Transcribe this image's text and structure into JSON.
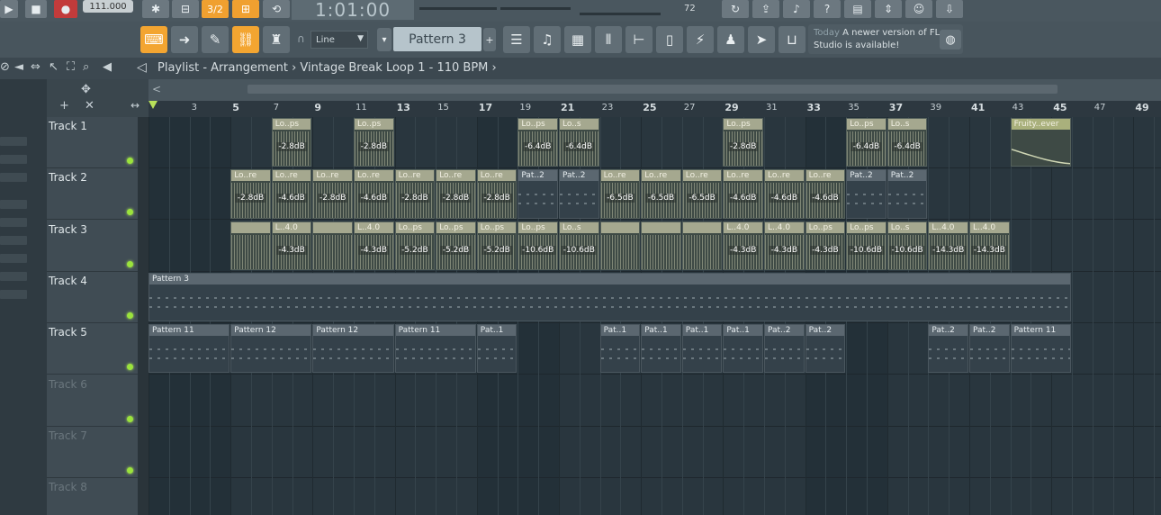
{
  "toolbar": {
    "tempo": "111.000",
    "time": "1:01:00",
    "volume_value": "72",
    "pattern_mode": "3/2",
    "snap": "Line",
    "pattern": "Pattern 3",
    "news_today": "Today",
    "news_text": "A newer version of FL Studio is available!"
  },
  "playlist": {
    "title": "Playlist - Arrangement › Vintage Break Loop 1 - 110 BPM ›"
  },
  "ruler": [
    {
      "bar": 1,
      "label": ""
    },
    {
      "bar": 3,
      "label": "3"
    },
    {
      "bar": 5,
      "label": "5"
    },
    {
      "bar": 7,
      "label": "7"
    },
    {
      "bar": 9,
      "label": "9"
    },
    {
      "bar": 11,
      "label": "11"
    },
    {
      "bar": 13,
      "label": "13"
    },
    {
      "bar": 15,
      "label": "15"
    },
    {
      "bar": 17,
      "label": "17"
    },
    {
      "bar": 19,
      "label": "19"
    },
    {
      "bar": 21,
      "label": "21"
    },
    {
      "bar": 23,
      "label": "23"
    },
    {
      "bar": 25,
      "label": "25"
    },
    {
      "bar": 27,
      "label": "27"
    },
    {
      "bar": 29,
      "label": "29"
    },
    {
      "bar": 31,
      "label": "31"
    },
    {
      "bar": 33,
      "label": "33"
    },
    {
      "bar": 35,
      "label": "35"
    },
    {
      "bar": 37,
      "label": "37"
    },
    {
      "bar": 39,
      "label": "39"
    },
    {
      "bar": 41,
      "label": "41"
    },
    {
      "bar": 43,
      "label": "43"
    },
    {
      "bar": 45,
      "label": "45"
    },
    {
      "bar": 47,
      "label": "47"
    },
    {
      "bar": 49,
      "label": "49"
    }
  ],
  "tracks": [
    {
      "name": "Track 1",
      "dim": false
    },
    {
      "name": "Track 2",
      "dim": false
    },
    {
      "name": "Track 3",
      "dim": false
    },
    {
      "name": "Track 4",
      "dim": false
    },
    {
      "name": "Track 5",
      "dim": false
    },
    {
      "name": "Track 6",
      "dim": true
    },
    {
      "name": "Track 7",
      "dim": true
    },
    {
      "name": "Track 8",
      "dim": true
    }
  ],
  "clips": [
    {
      "track": 0,
      "start": 7,
      "len": 2,
      "kind": "audio",
      "label": "Lo..ps",
      "db": "-2.8dB"
    },
    {
      "track": 0,
      "start": 11,
      "len": 2,
      "kind": "audio",
      "label": "Lo..ps",
      "db": "-2.8dB"
    },
    {
      "track": 0,
      "start": 19,
      "len": 2,
      "kind": "audio",
      "label": "Lo..ps",
      "db": "-6.4dB"
    },
    {
      "track": 0,
      "start": 21,
      "len": 2,
      "kind": "audio",
      "label": "Lo..s",
      "db": "-6.4dB"
    },
    {
      "track": 0,
      "start": 29,
      "len": 2,
      "kind": "audio",
      "label": "Lo..ps",
      "db": "-2.8dB"
    },
    {
      "track": 0,
      "start": 35,
      "len": 2,
      "kind": "audio",
      "label": "Lo..ps",
      "db": "-6.4dB"
    },
    {
      "track": 0,
      "start": 37,
      "len": 2,
      "kind": "audio",
      "label": "Lo..s",
      "db": "-6.4dB"
    },
    {
      "track": 0,
      "start": 43,
      "len": 3,
      "kind": "auto",
      "label": "Fruity..ever",
      "db": ""
    },
    {
      "track": 1,
      "start": 5,
      "len": 2,
      "kind": "audio",
      "label": "Lo..re",
      "db": "-2.8dB"
    },
    {
      "track": 1,
      "start": 7,
      "len": 2,
      "kind": "audio",
      "label": "Lo..re",
      "db": "-4.6dB"
    },
    {
      "track": 1,
      "start": 9,
      "len": 2,
      "kind": "audio",
      "label": "Lo..re",
      "db": "-2.8dB"
    },
    {
      "track": 1,
      "start": 11,
      "len": 2,
      "kind": "audio",
      "label": "Lo..re",
      "db": "-4.6dB"
    },
    {
      "track": 1,
      "start": 13,
      "len": 2,
      "kind": "audio",
      "label": "Lo..re",
      "db": "-2.8dB"
    },
    {
      "track": 1,
      "start": 15,
      "len": 2,
      "kind": "audio",
      "label": "Lo..re",
      "db": "-2.8dB"
    },
    {
      "track": 1,
      "start": 17,
      "len": 2,
      "kind": "audio",
      "label": "Lo..re",
      "db": "-2.8dB"
    },
    {
      "track": 1,
      "start": 19,
      "len": 2,
      "kind": "pattern",
      "label": "Pat..2",
      "db": ""
    },
    {
      "track": 1,
      "start": 21,
      "len": 2,
      "kind": "pattern",
      "label": "Pat..2",
      "db": ""
    },
    {
      "track": 1,
      "start": 23,
      "len": 2,
      "kind": "audio",
      "label": "Lo..re",
      "db": "-6.5dB"
    },
    {
      "track": 1,
      "start": 25,
      "len": 2,
      "kind": "audio",
      "label": "Lo..re",
      "db": "-6.5dB"
    },
    {
      "track": 1,
      "start": 27,
      "len": 2,
      "kind": "audio",
      "label": "Lo..re",
      "db": "-6.5dB"
    },
    {
      "track": 1,
      "start": 29,
      "len": 2,
      "kind": "audio",
      "label": "Lo..re",
      "db": "-4.6dB"
    },
    {
      "track": 1,
      "start": 31,
      "len": 2,
      "kind": "audio",
      "label": "Lo..re",
      "db": "-4.6dB"
    },
    {
      "track": 1,
      "start": 33,
      "len": 2,
      "kind": "audio",
      "label": "Lo..re",
      "db": "-4.6dB"
    },
    {
      "track": 1,
      "start": 35,
      "len": 2,
      "kind": "pattern",
      "label": "Pat..2",
      "db": ""
    },
    {
      "track": 1,
      "start": 37,
      "len": 2,
      "kind": "pattern",
      "label": "Pat..2",
      "db": ""
    },
    {
      "track": 2,
      "start": 5,
      "len": 2,
      "kind": "audio",
      "label": "",
      "db": ""
    },
    {
      "track": 2,
      "start": 7,
      "len": 2,
      "kind": "audio",
      "label": "L..4.0",
      "db": "-4.3dB"
    },
    {
      "track": 2,
      "start": 9,
      "len": 2,
      "kind": "audio",
      "label": "",
      "db": ""
    },
    {
      "track": 2,
      "start": 11,
      "len": 2,
      "kind": "audio",
      "label": "L..4.0",
      "db": "-4.3dB"
    },
    {
      "track": 2,
      "start": 13,
      "len": 2,
      "kind": "audio",
      "label": "Lo..ps",
      "db": "-5.2dB"
    },
    {
      "track": 2,
      "start": 15,
      "len": 2,
      "kind": "audio",
      "label": "Lo..ps",
      "db": "-5.2dB"
    },
    {
      "track": 2,
      "start": 17,
      "len": 2,
      "kind": "audio",
      "label": "Lo..ps",
      "db": "-5.2dB"
    },
    {
      "track": 2,
      "start": 19,
      "len": 2,
      "kind": "audio",
      "label": "Lo..ps",
      "db": "-10.6dB"
    },
    {
      "track": 2,
      "start": 21,
      "len": 2,
      "kind": "audio",
      "label": "Lo..s",
      "db": "-10.6dB"
    },
    {
      "track": 2,
      "start": 23,
      "len": 2,
      "kind": "audio",
      "label": "",
      "db": ""
    },
    {
      "track": 2,
      "start": 25,
      "len": 2,
      "kind": "audio",
      "label": "",
      "db": ""
    },
    {
      "track": 2,
      "start": 27,
      "len": 2,
      "kind": "audio",
      "label": "",
      "db": ""
    },
    {
      "track": 2,
      "start": 29,
      "len": 2,
      "kind": "audio",
      "label": "L..4.0",
      "db": "-4.3dB"
    },
    {
      "track": 2,
      "start": 31,
      "len": 2,
      "kind": "audio",
      "label": "L..4.0",
      "db": "-4.3dB"
    },
    {
      "track": 2,
      "start": 33,
      "len": 2,
      "kind": "audio",
      "label": "Lo..ps",
      "db": "-4.3dB"
    },
    {
      "track": 2,
      "start": 35,
      "len": 2,
      "kind": "audio",
      "label": "Lo..ps",
      "db": "-10.6dB"
    },
    {
      "track": 2,
      "start": 37,
      "len": 2,
      "kind": "audio",
      "label": "Lo..s",
      "db": "-10.6dB"
    },
    {
      "track": 2,
      "start": 39,
      "len": 2,
      "kind": "audio",
      "label": "L..4.0",
      "db": "-14.3dB"
    },
    {
      "track": 2,
      "start": 41,
      "len": 2,
      "kind": "audio",
      "label": "L..4.0",
      "db": "-14.3dB"
    },
    {
      "track": 3,
      "start": 1,
      "len": 45,
      "kind": "pattern",
      "label": "Pattern 3",
      "db": ""
    },
    {
      "track": 4,
      "start": 1,
      "len": 4,
      "kind": "pattern",
      "label": "Pattern 11",
      "db": ""
    },
    {
      "track": 4,
      "start": 5,
      "len": 4,
      "kind": "pattern",
      "label": "Pattern 12",
      "db": ""
    },
    {
      "track": 4,
      "start": 9,
      "len": 4,
      "kind": "pattern",
      "label": "Pattern 12",
      "db": ""
    },
    {
      "track": 4,
      "start": 13,
      "len": 4,
      "kind": "pattern",
      "label": "Pattern 11",
      "db": ""
    },
    {
      "track": 4,
      "start": 17,
      "len": 2,
      "kind": "pattern",
      "label": "Pat..1",
      "db": ""
    },
    {
      "track": 4,
      "start": 23,
      "len": 2,
      "kind": "pattern",
      "label": "Pat..1",
      "db": ""
    },
    {
      "track": 4,
      "start": 25,
      "len": 2,
      "kind": "pattern",
      "label": "Pat..1",
      "db": ""
    },
    {
      "track": 4,
      "start": 27,
      "len": 2,
      "kind": "pattern",
      "label": "Pat..1",
      "db": ""
    },
    {
      "track": 4,
      "start": 29,
      "len": 2,
      "kind": "pattern",
      "label": "Pat..1",
      "db": ""
    },
    {
      "track": 4,
      "start": 31,
      "len": 2,
      "kind": "pattern",
      "label": "Pat..2",
      "db": ""
    },
    {
      "track": 4,
      "start": 33,
      "len": 2,
      "kind": "pattern",
      "label": "Pat..2",
      "db": ""
    },
    {
      "track": 4,
      "start": 39,
      "len": 2,
      "kind": "pattern",
      "label": "Pat..2",
      "db": ""
    },
    {
      "track": 4,
      "start": 41,
      "len": 2,
      "kind": "pattern",
      "label": "Pat..2",
      "db": ""
    },
    {
      "track": 4,
      "start": 43,
      "len": 3,
      "kind": "pattern",
      "label": "Pattern 11",
      "db": ""
    }
  ]
}
